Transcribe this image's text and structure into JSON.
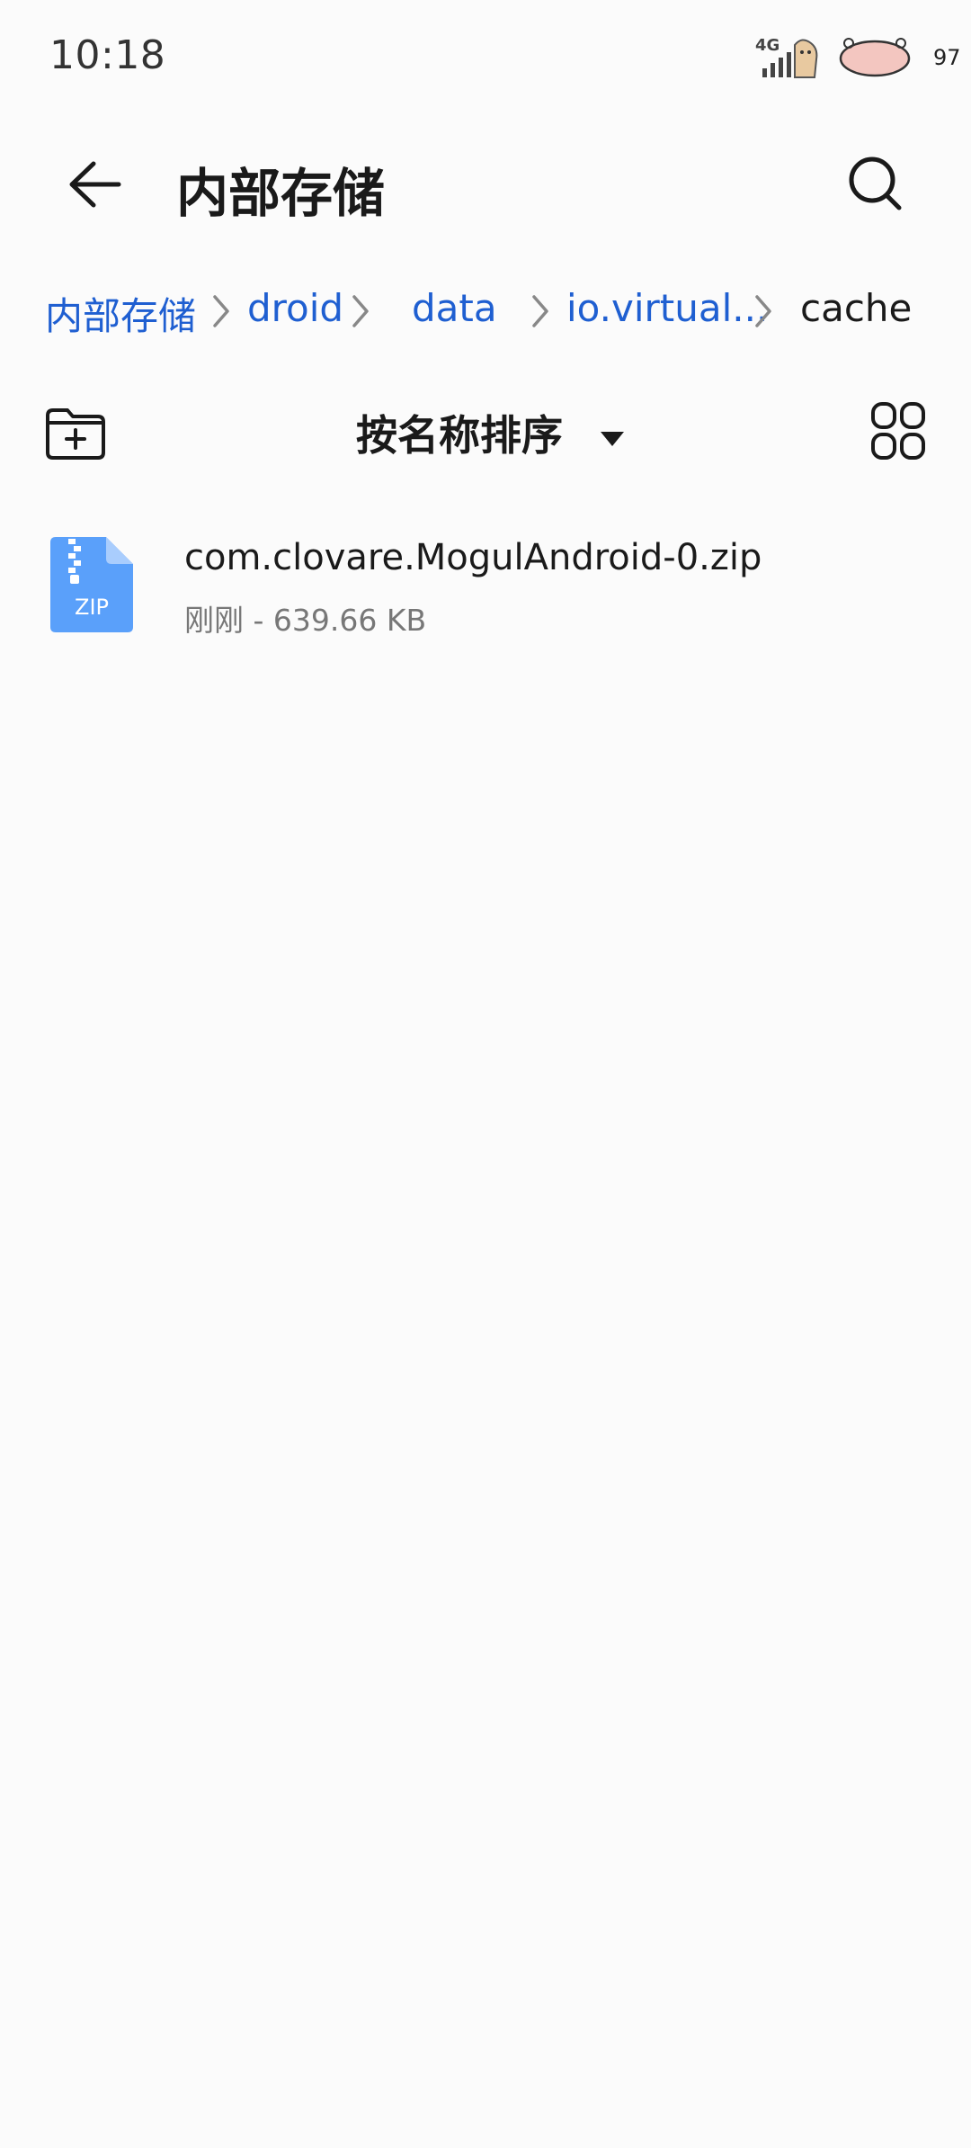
{
  "status_bar": {
    "time": "10:18",
    "network": "4G",
    "battery": "97",
    "icons": [
      "signal-icon",
      "battery-icon"
    ]
  },
  "header": {
    "title": "内部存储",
    "back_icon": "arrow-left-icon",
    "search_icon": "search-icon"
  },
  "breadcrumb": {
    "items": [
      {
        "label": "内部存储",
        "current": false
      },
      {
        "label": "droid",
        "current": false
      },
      {
        "label": "data",
        "current": false
      },
      {
        "label": "io.virtual...",
        "current": false
      },
      {
        "label": "cache",
        "current": true
      }
    ]
  },
  "toolbar": {
    "new_folder_icon": "new-folder-icon",
    "sort_label": "按名称排序",
    "view_icon": "grid-view-icon"
  },
  "files": [
    {
      "name": "com.clovare.MogulAndroid-0.zip",
      "meta": "刚刚 - 639.66 KB",
      "icon": "zip-file-icon",
      "icon_label": "ZIP"
    }
  ],
  "colors": {
    "link": "#1f5fd1",
    "zip_icon": "#5aa0fa",
    "background": "#fbfbfb"
  }
}
